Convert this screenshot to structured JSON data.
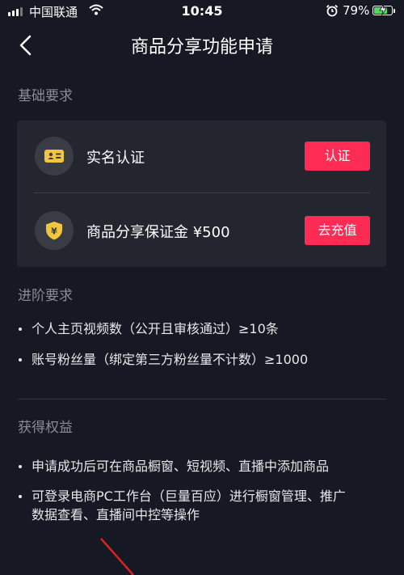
{
  "status_bar": {
    "carrier": "中国联通",
    "time": "10:45",
    "battery": "79%",
    "battery_level": 0.79,
    "icons": [
      "signal-icon",
      "wifi-icon",
      "alarm-icon",
      "battery-icon"
    ]
  },
  "nav": {
    "title": "商品分享功能申请",
    "back_icon": "back-chevron-icon"
  },
  "basic": {
    "label": "基础要求",
    "rows": [
      {
        "label": "实名认证",
        "button": "认证",
        "icon": "id-card-icon"
      },
      {
        "label": "商品分享保证金 ¥500",
        "button": "去充值",
        "icon": "shield-yen-icon"
      }
    ]
  },
  "advanced": {
    "label": "进阶要求",
    "items": [
      "个人主页视频数（公开且审核通过）≥10条",
      "账号粉丝量（绑定第三方粉丝量不计数）≥1000"
    ]
  },
  "benefits": {
    "label": "获得权益",
    "items": [
      "申请成功后可在商品橱窗、短视频、直播中添加商品",
      "可登录电商PC工作台（巨量百应）进行橱窗管理、推广",
      "数据查看、直播间中控等操作"
    ]
  },
  "colors": {
    "background": "#161823",
    "card": "#24262f",
    "accent": "#fe2c55",
    "icon_yellow": "#f4c63d"
  }
}
